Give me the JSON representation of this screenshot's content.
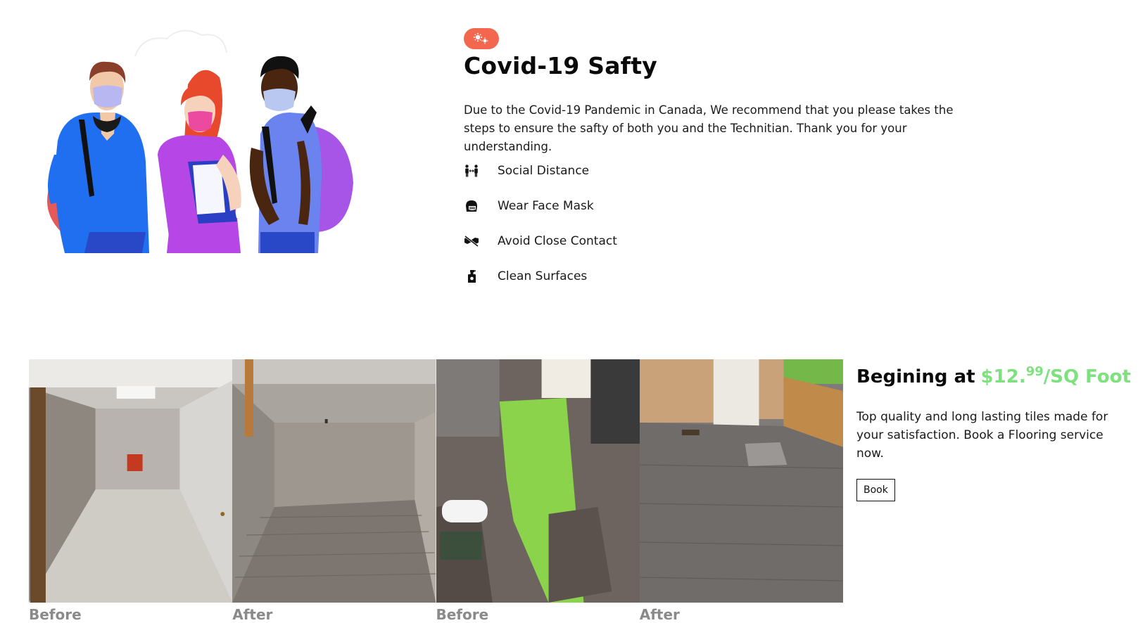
{
  "covid": {
    "badge_icon": "virus-icon",
    "title": "Covid-19 Safty",
    "description": "Due to the Covid-19 Pandemic in Canada, We recommend that you please takes the steps to ensure the safty of both you and the Technitian. Thank you for your understanding.",
    "rules": [
      {
        "icon": "social-distance-icon",
        "label": "Social Distance"
      },
      {
        "icon": "face-mask-icon",
        "label": "Wear Face Mask"
      },
      {
        "icon": "no-handshake-icon",
        "label": "Avoid Close Contact"
      },
      {
        "icon": "spray-bottle-icon",
        "label": "Clean Surfaces"
      }
    ]
  },
  "gallery": {
    "captions": [
      "Before",
      "After",
      "Before",
      "After"
    ]
  },
  "pricing": {
    "heading": "Begining at",
    "price_main": "$12.",
    "price_cents": "99",
    "price_unit": "/SQ Foot",
    "description": "Top quality and long lasting tiles made for your satisfaction. Book a Flooring service now.",
    "book_label": "Book"
  },
  "colors": {
    "badge": "#f4674f",
    "price": "#7ee07e",
    "caption": "#8a8a8a"
  }
}
